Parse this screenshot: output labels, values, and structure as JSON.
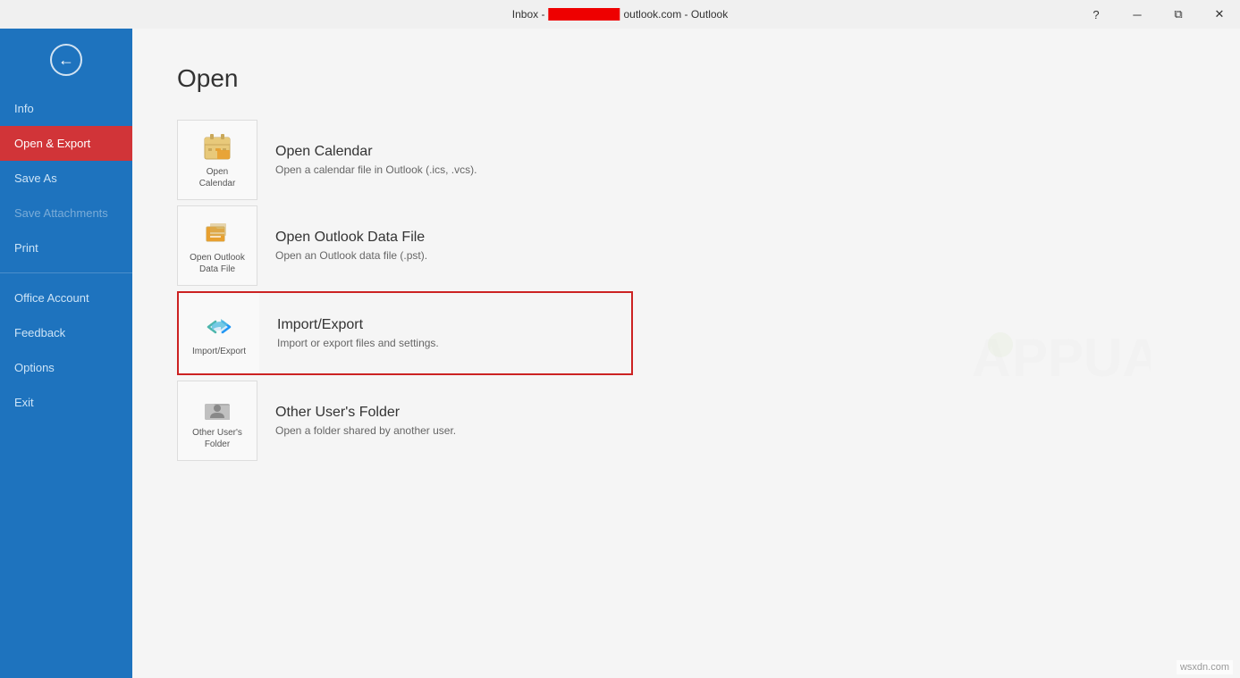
{
  "titlebar": {
    "prefix": "Inbox - ",
    "suffix": "outlook.com  -  Outlook",
    "help_label": "?",
    "minimize_label": "─",
    "restore_label": "⧉",
    "close_label": "✕"
  },
  "sidebar": {
    "back_title": "back",
    "items": [
      {
        "id": "info",
        "label": "Info",
        "active": false,
        "disabled": false
      },
      {
        "id": "open-export",
        "label": "Open & Export",
        "active": true,
        "disabled": false
      },
      {
        "id": "save-as",
        "label": "Save As",
        "active": false,
        "disabled": false
      },
      {
        "id": "save-attachments",
        "label": "Save Attachments",
        "active": false,
        "disabled": true
      },
      {
        "id": "print",
        "label": "Print",
        "active": false,
        "disabled": false
      },
      {
        "id": "divider1",
        "type": "divider"
      },
      {
        "id": "office-account",
        "label": "Office Account",
        "active": false,
        "disabled": false
      },
      {
        "id": "feedback",
        "label": "Feedback",
        "active": false,
        "disabled": false
      },
      {
        "id": "options",
        "label": "Options",
        "active": false,
        "disabled": false
      },
      {
        "id": "exit",
        "label": "Exit",
        "active": false,
        "disabled": false
      }
    ]
  },
  "main": {
    "page_title": "Open",
    "options": [
      {
        "id": "open-calendar",
        "icon_label": "Open\nCalendar",
        "title": "Open Calendar",
        "description": "Open a calendar file in Outlook (.ics, .vcs).",
        "highlighted": false
      },
      {
        "id": "open-outlook-data-file",
        "icon_label": "Open Outlook\nData File",
        "title": "Open Outlook Data File",
        "description": "Open an Outlook data file (.pst).",
        "highlighted": false
      },
      {
        "id": "import-export",
        "icon_label": "Import/Export",
        "title": "Import/Export",
        "description": "Import or export files and settings.",
        "highlighted": true
      },
      {
        "id": "other-users-folder",
        "icon_label": "Other User's\nFolder",
        "title": "Other User's Folder",
        "description": "Open a folder shared by another user.",
        "highlighted": false
      }
    ]
  },
  "watermark": {
    "text": "A🎓PPUALS"
  },
  "footer": {
    "badge": "wsxdn.com"
  }
}
